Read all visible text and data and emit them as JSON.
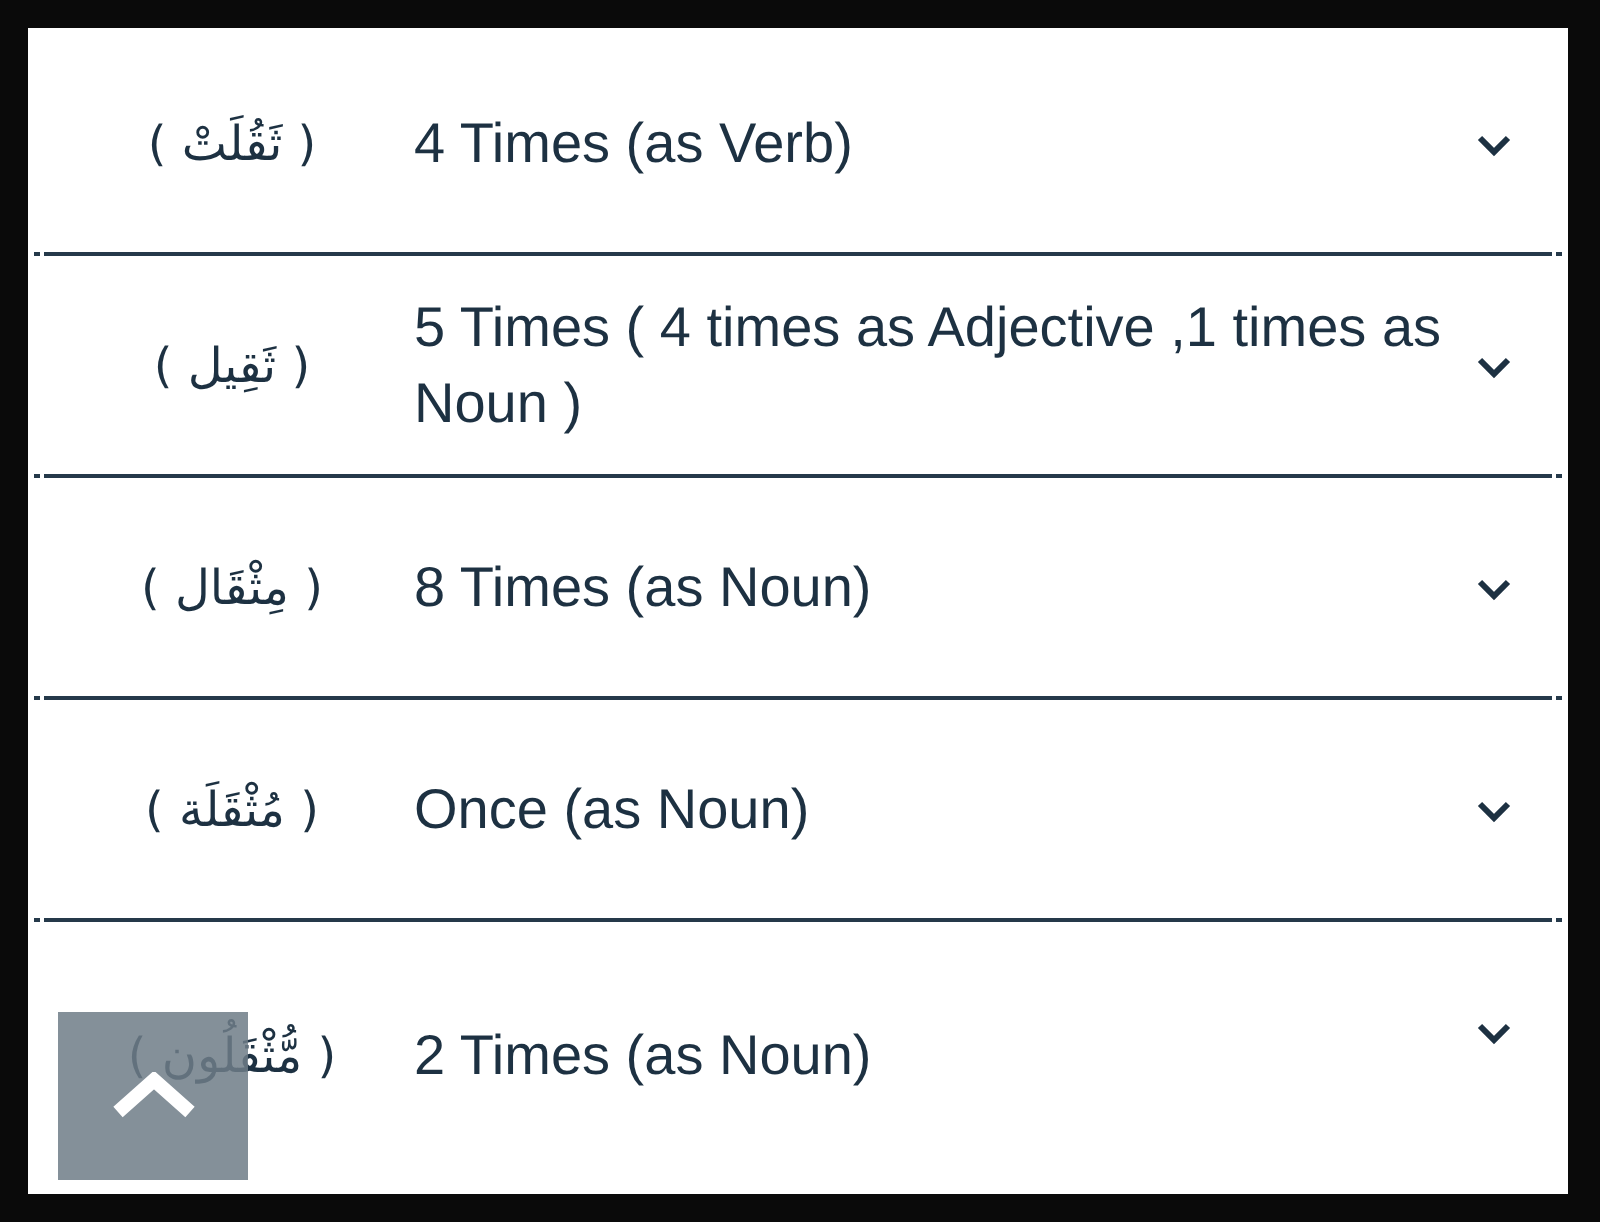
{
  "rows": [
    {
      "word": "( ثَقُلَتْ )",
      "occurrences": "4 Times (as Verb)",
      "expanded": false
    },
    {
      "word": "( ثَقِيل )",
      "occurrences": "5 Times ( 4 times as Adjective ,1 times as Noun )",
      "expanded": false
    },
    {
      "word": "( مِثْقَال )",
      "occurrences": "8 Times (as Noun)",
      "expanded": false
    },
    {
      "word": "( مُثْقَلَة )",
      "occurrences": "Once (as Noun)",
      "expanded": false
    },
    {
      "word": "( مُّثْقَلُون )",
      "occurrences": "2 Times (as Noun)",
      "expanded": false
    }
  ],
  "scroll_top_button": {
    "kind": "up"
  }
}
